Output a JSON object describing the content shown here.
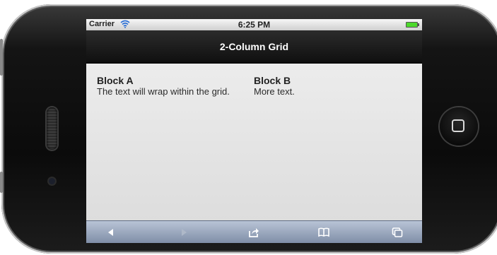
{
  "status_bar": {
    "carrier": "Carrier",
    "time": "6:25 PM"
  },
  "nav": {
    "title": "2-Column Grid"
  },
  "blocks": [
    {
      "title": "Block A",
      "text": "The text will wrap within the grid."
    },
    {
      "title": "Block B",
      "text": "More text."
    }
  ],
  "toolbar": {
    "icons": [
      "back-arrow-icon",
      "forward-arrow-icon",
      "share-icon",
      "bookmarks-icon",
      "pages-icon"
    ]
  },
  "colors": {
    "nav_bar": "#1a1a1a",
    "toolbar": "#9aa7bc",
    "content_bg": "#e2e2e2",
    "battery": "#4cd92b"
  }
}
